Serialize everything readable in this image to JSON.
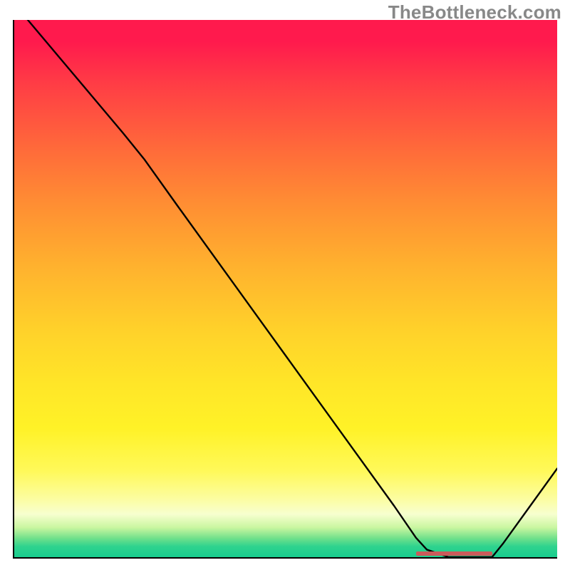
{
  "watermark": "TheBottleneck.com",
  "colors": {
    "curve": "#000000",
    "trough_marker": "#c95b5b",
    "axis": "#000000"
  },
  "chart_data": {
    "type": "line",
    "title": "",
    "xlabel": "",
    "ylabel": "",
    "xlim": [
      0,
      100
    ],
    "ylim": [
      0,
      100
    ],
    "x": [
      0,
      5,
      10,
      15,
      20,
      24,
      30,
      40,
      50,
      60,
      70,
      74,
      76,
      80,
      85,
      88,
      90,
      95,
      100
    ],
    "values": [
      103,
      97,
      91,
      85,
      79,
      74,
      65.5,
      51.5,
      37.5,
      23.5,
      9.5,
      3.6,
      1.4,
      0,
      0,
      0,
      2.5,
      9.5,
      16.5
    ],
    "series_name": "bottleneck_curve",
    "trough_marker": {
      "x_start": 74,
      "x_end": 88,
      "y": 0.6
    },
    "legend": false,
    "grid": false
  }
}
